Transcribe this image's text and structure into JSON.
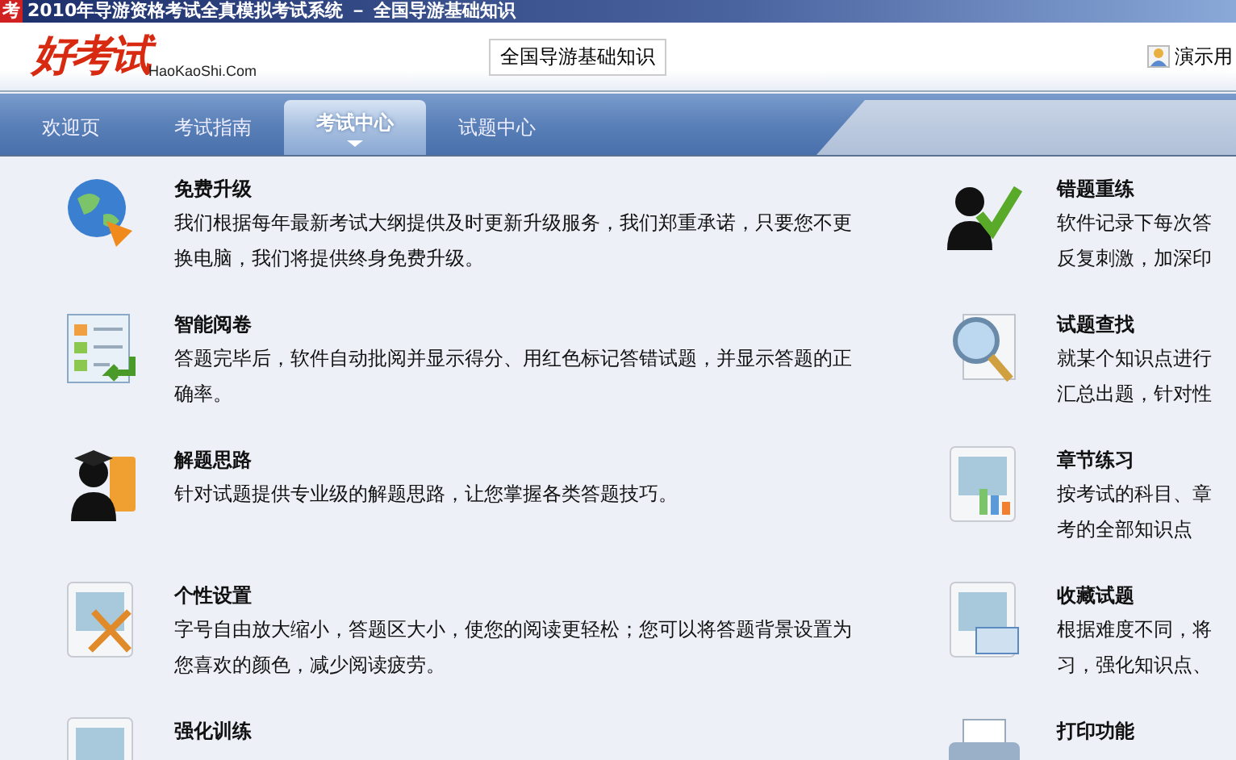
{
  "window": {
    "icon_text": "考",
    "title": "2010年导游资格考试全真模拟考试系统 － 全国导游基础知识"
  },
  "header": {
    "logo_text": "好考试",
    "logo_domain": "HaoKaoShi.Com",
    "subject_button": "全国导游基础知识",
    "user": "演示用"
  },
  "tabs": [
    {
      "label": "欢迎页",
      "selected": false
    },
    {
      "label": "考试指南",
      "selected": false
    },
    {
      "label": "考试中心",
      "selected": true
    },
    {
      "label": "试题中心",
      "selected": false
    }
  ],
  "features_left": [
    {
      "title": "免费升级",
      "lines": [
        "我们根据每年最新考试大纲提供及时更新升级服务，我们郑重承诺，只要您不更",
        "换电脑，我们将提供终身免费升级。"
      ]
    },
    {
      "title": "智能阅卷",
      "lines": [
        "答题完毕后，软件自动批阅并显示得分、用红色标记答错试题，并显示答题的正",
        "确率。"
      ]
    },
    {
      "title": "解题思路",
      "lines": [
        "针对试题提供专业级的解题思路，让您掌握各类答题技巧。"
      ]
    },
    {
      "title": "个性设置",
      "lines": [
        "字号自由放大缩小，答题区大小，使您的阅读更轻松；您可以将答题背景设置为",
        "您喜欢的颜色，减少阅读疲劳。"
      ]
    },
    {
      "title": "强化训练"
    }
  ],
  "features_right": [
    {
      "title": "错题重练",
      "lines": [
        "软件记录下每次答",
        "反复刺激，加深印"
      ]
    },
    {
      "title": "试题查找",
      "lines": [
        "就某个知识点进行",
        "汇总出题，针对性"
      ]
    },
    {
      "title": "章节练习",
      "lines": [
        "按考试的科目、章",
        "考的全部知识点"
      ]
    },
    {
      "title": "收藏试题",
      "lines": [
        "根据难度不同，将",
        "习，强化知识点、"
      ]
    },
    {
      "title": "打印功能"
    }
  ]
}
